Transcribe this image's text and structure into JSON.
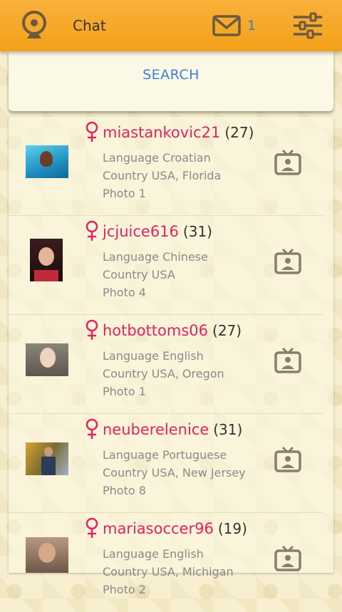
{
  "app": {
    "title": "Chat",
    "message_count": "1",
    "search_label": "SEARCH"
  },
  "users": [
    {
      "username": "miastankovic21",
      "age": "(27)",
      "language": "Language Croatian",
      "country": "Country USA, Florida",
      "photos": "Photo 1"
    },
    {
      "username": "jcjuice616",
      "age": "(31)",
      "language": "Language Chinese",
      "country": "Country USA",
      "photos": "Photo 4"
    },
    {
      "username": "hotbottoms06",
      "age": "(27)",
      "language": "Language English",
      "country": "Country USA, Oregon",
      "photos": "Photo 1"
    },
    {
      "username": "neuberelenice",
      "age": "(31)",
      "language": "Language Portuguese",
      "country": "Country USA, New Jersey",
      "photos": "Photo 8"
    },
    {
      "username": "mariasoccer96",
      "age": "(19)",
      "language": "Language English",
      "country": "Country USA, Michigan",
      "photos": "Photo 2"
    }
  ],
  "colors": {
    "topbar": "#f5a623",
    "username": "#e0245e",
    "accent": "#3e7fd8"
  },
  "icons": [
    "webcam-icon",
    "mail-icon",
    "filter-sliders-icon",
    "female-symbol-icon",
    "video-chat-icon"
  ]
}
